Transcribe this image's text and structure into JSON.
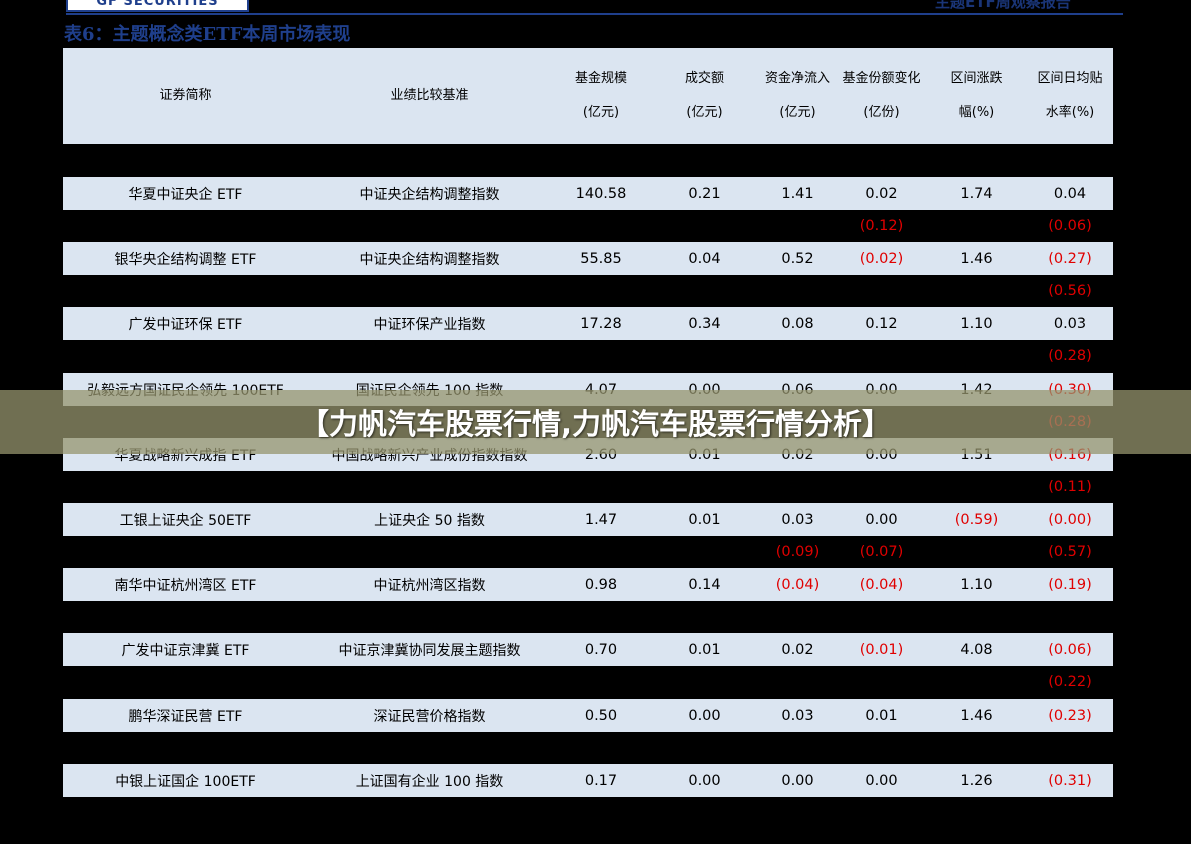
{
  "header": {
    "logo_text": "GF SECURITIES",
    "report_label": "主题ETF周观察报告",
    "caption": "表6：主题概念类ETF本周市场表现"
  },
  "table": {
    "columns": [
      {
        "line1": "证券简称",
        "line2": ""
      },
      {
        "line1": "业绩比较基准",
        "line2": ""
      },
      {
        "line1": "基金规模",
        "line2": "(亿元)"
      },
      {
        "line1": "成交额",
        "line2": "(亿元)"
      },
      {
        "line1": "资金净流入",
        "line2": "(亿元)"
      },
      {
        "line1": "基金份额变化",
        "line2": "(亿份)"
      },
      {
        "line1": "区间涨跌",
        "line2": "幅(%)"
      },
      {
        "line1": "区间日均贴",
        "line2": "水率(%)"
      }
    ],
    "rows": [
      {
        "name": "华夏中证央企 ETF",
        "bench": "中证央企结构调整指数",
        "size": "140.58",
        "turnover": "0.21",
        "inflow": "1.41",
        "share": "0.02",
        "chg": "1.74",
        "disc": "0.04"
      },
      {
        "name": "银华央企结构调整 ETF",
        "bench": "中证央企结构调整指数",
        "size": "55.85",
        "turnover": "0.04",
        "inflow": "0.52",
        "share": "(0.02)",
        "chg": "1.46",
        "disc": "(0.27)"
      },
      {
        "name": "广发中证环保 ETF",
        "bench": "中证环保产业指数",
        "size": "17.28",
        "turnover": "0.34",
        "inflow": "0.08",
        "share": "0.12",
        "chg": "1.10",
        "disc": "0.03"
      },
      {
        "name": "弘毅远方国证民企领先 100ETF",
        "bench": "国证民企领先 100 指数",
        "size": "4.07",
        "turnover": "0.00",
        "inflow": "0.06",
        "share": "0.00",
        "chg": "1.42",
        "disc": "(0.30)"
      },
      {
        "name": "华夏战略新兴成指 ETF",
        "bench": "中国战略新兴产业成份指数指数",
        "size": "2.60",
        "turnover": "0.01",
        "inflow": "0.02",
        "share": "0.00",
        "chg": "1.51",
        "disc": "(0.16)"
      },
      {
        "name": "工银上证央企 50ETF",
        "bench": "上证央企 50 指数",
        "size": "1.47",
        "turnover": "0.01",
        "inflow": "0.03",
        "share": "0.00",
        "chg": "(0.59)",
        "disc": "(0.00)"
      },
      {
        "name": "南华中证杭州湾区 ETF",
        "bench": "中证杭州湾区指数",
        "size": "0.98",
        "turnover": "0.14",
        "inflow": "(0.04)",
        "share": "(0.04)",
        "chg": "1.10",
        "disc": "(0.19)"
      },
      {
        "name": "广发中证京津冀 ETF",
        "bench": "中证京津冀协同发展主题指数",
        "size": "0.70",
        "turnover": "0.01",
        "inflow": "0.02",
        "share": "(0.01)",
        "chg": "4.08",
        "disc": "(0.06)"
      },
      {
        "name": "鹏华深证民营 ETF",
        "bench": "深证民营价格指数",
        "size": "0.50",
        "turnover": "0.00",
        "inflow": "0.03",
        "share": "0.01",
        "chg": "1.46",
        "disc": "(0.23)"
      },
      {
        "name": "中银上证国企 100ETF",
        "bench": "上证国有企业 100 指数",
        "size": "0.17",
        "turnover": "0.00",
        "inflow": "0.00",
        "share": "0.00",
        "chg": "1.26",
        "disc": "(0.31)"
      }
    ],
    "gap_rows": [
      {
        "after": 0,
        "share": "(0.12)",
        "disc": "(0.06)"
      },
      {
        "after": 1,
        "disc": "(0.56)"
      },
      {
        "after": 2,
        "disc": "(0.28)"
      },
      {
        "after": 3,
        "disc": "(0.28)"
      },
      {
        "after": 4,
        "disc": "(0.11)"
      },
      {
        "after": 5,
        "inflow": "(0.09)",
        "share": "(0.07)",
        "disc": "(0.57)"
      },
      {
        "after": 6
      },
      {
        "after": 7,
        "disc": "(0.22)"
      },
      {
        "after": 8
      }
    ]
  },
  "overlay": {
    "title": "【力帆汽车股票行情,力帆汽车股票行情分析】"
  },
  "colors": {
    "row_bg": "#dbe5f1",
    "negative": "#e00000",
    "brand": "#1f3f8c"
  }
}
